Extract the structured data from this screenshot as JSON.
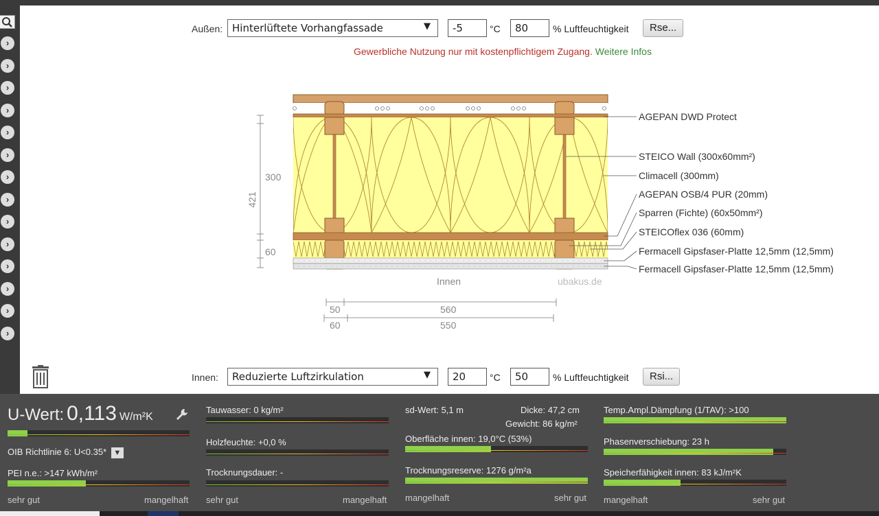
{
  "outside": {
    "label": "Außen:",
    "construction": "Hinterlüftete Vorhangfassade",
    "temp": "-5",
    "temp_unit": "°C",
    "humidity": "80",
    "humidity_unit": "% Luftfeuchtigkeit",
    "r_button": "Rse..."
  },
  "notice": {
    "text": "Gewerbliche Nutzung nur mit kostenpflichtigem Zugang.",
    "link": "Weitere Infos"
  },
  "drawing": {
    "layers": [
      "AGEPAN DWD Protect",
      "STEICO  Wall (300x60mm²)",
      "Climacell (300mm)",
      "AGEPAN OSB/4 PUR (20mm)",
      "Sparren (Fichte) (60x50mm²)",
      "STEICOflex 036 (60mm)",
      "Fermacell Gipsfaser-Platte 12,5mm (12,5mm)",
      "Fermacell Gipsfaser-Platte 12,5mm (12,5mm)"
    ],
    "dim_total": "421",
    "dim_upper": "300",
    "dim_lower": "60",
    "innen": "Innen",
    "watermark": "ubakus.de",
    "dims_bottom": {
      "a": "50",
      "b": "560",
      "c": "60",
      "d": "550"
    }
  },
  "inside": {
    "label": "Innen:",
    "construction": "Reduzierte Luftzirkulation",
    "temp": "20",
    "temp_unit": "°C",
    "humidity": "50",
    "humidity_unit": "% Luftfeuchtigkeit",
    "r_button": "Rsi..."
  },
  "results": {
    "u_label": "U-Wert:",
    "u_value": "0,113",
    "u_unit": "W/m²K",
    "u_fill": 0.11,
    "oib": "OIB Richtlinie 6: U<0.35*",
    "pei": "PEI n.e.: >147 kWh/m²",
    "pei_fill": 0.43,
    "scale_good": "sehr gut",
    "scale_bad": "mangelhaft",
    "tauwasser": "Tauwasser: 0 kg/m²",
    "holzfeuchte": "Holzfeuchte: +0,0 %",
    "trocknungsdauer": "Trocknungsdauer: -",
    "sd": "sd-Wert: 5,1 m",
    "dicke": "Dicke: 47,2 cm",
    "gewicht": "Gewicht: 86 kg/m²",
    "oberflaeche": "Oberfläche innen: 19,0°C (53%)",
    "oberflaeche_fill": 0.47,
    "reserve": "Trocknungsreserve: 1276 g/m²a",
    "reserve_fill": 1.0,
    "tav": "Temp.Ampl.Dämpfung (1/TAV): >100",
    "tav_fill": 1.0,
    "phase": "Phasenverschiebung: 23 h",
    "phase_fill": 0.93,
    "speicher": "Speicherfähigkeit innen: 83 kJ/m²K",
    "speicher_fill": 0.42
  }
}
